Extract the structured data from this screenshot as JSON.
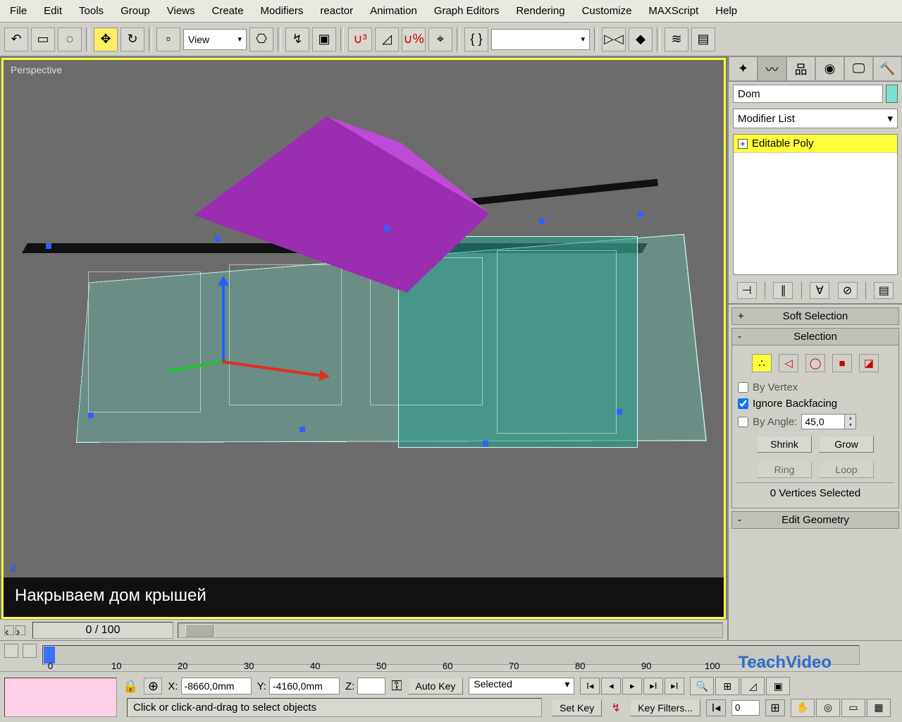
{
  "menu": {
    "file": "File",
    "edit": "Edit",
    "tools": "Tools",
    "group": "Group",
    "views": "Views",
    "create": "Create",
    "modifiers": "Modifiers",
    "reactor": "reactor",
    "animation": "Animation",
    "graph": "Graph Editors",
    "rendering": "Rendering",
    "customize": "Customize",
    "maxscript": "MAXScript",
    "help": "Help"
  },
  "toolbar": {
    "view_sel": "View"
  },
  "viewport": {
    "label": "Perspective",
    "caption": "Накрываем дом крышей"
  },
  "timeline": {
    "frame": "0 / 100",
    "ticks": [
      "0",
      "10",
      "20",
      "30",
      "40",
      "50",
      "60",
      "70",
      "80",
      "90",
      "100"
    ]
  },
  "cmd": {
    "object_name": "Dom",
    "modifier_list": "Modifier List",
    "stack_item": "Editable Poly",
    "roll_soft": "Soft Selection",
    "roll_sel": "Selection",
    "by_vertex": "By Vertex",
    "ignore_bf": "Ignore Backfacing",
    "by_angle": "By Angle:",
    "angle_val": "45,0",
    "shrink": "Shrink",
    "grow": "Grow",
    "ring": "Ring",
    "loop": "Loop",
    "sel_count": "0 Vertices Selected",
    "roll_editgeo": "Edit Geometry"
  },
  "status": {
    "x": "-8660,0mm",
    "y": "-4160,0mm",
    "z": "",
    "prompt": "Click or click-and-drag to select objects",
    "autokey": "Auto Key",
    "setkey": "Set Key",
    "anim_sel": "Selected",
    "keyfilters": "Key Filters..."
  },
  "logo": {
    "a": "Teach",
    "b": "Video"
  }
}
